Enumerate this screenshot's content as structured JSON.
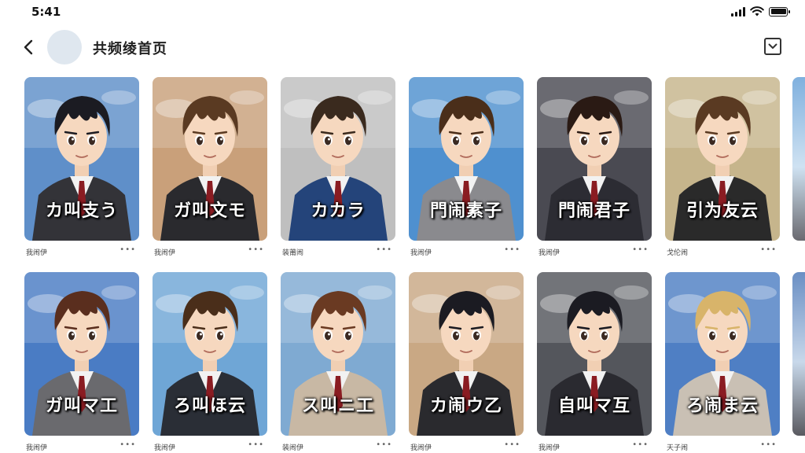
{
  "status": {
    "time": "5:41"
  },
  "header": {
    "title": "共频绫首页"
  },
  "icons": {
    "back": "chevron-left-icon",
    "menu": "dropdown-box-icon",
    "signal": "cellular-signal-icon",
    "wifi": "wifi-icon",
    "battery": "battery-icon"
  },
  "colors": {
    "accent": "#111111",
    "avatar": "#dfe7ef"
  },
  "rows": [
    [
      {
        "title": "カ叫支う",
        "caption": "我闹伊",
        "dots": "•••",
        "bg": "#5f8fc9",
        "hair": "#1b1b22",
        "jacket": "#333338"
      },
      {
        "title": "ガ叫文モ",
        "caption": "我闹伊",
        "dots": "•••",
        "bg": "#c9a07a",
        "hair": "#5a3a22",
        "jacket": "#2a2a2e"
      },
      {
        "title": "カカラ",
        "caption": "装莆闹",
        "dots": "•••",
        "bg": "#bfbfbf",
        "hair": "#3a2a1e",
        "jacket": "#24447a"
      },
      {
        "title": "門闹素子",
        "caption": "我闹伊",
        "dots": "•••",
        "bg": "#4f90cf",
        "hair": "#4a2e1a",
        "jacket": "#8a8a8e"
      },
      {
        "title": "門闹君子",
        "caption": "我闹伊",
        "dots": "•••",
        "bg": "#4a4a52",
        "hair": "#2a1a14",
        "jacket": "#2c2c33"
      },
      {
        "title": "引为友云",
        "caption": "戈伦闹",
        "dots": "•••",
        "bg": "#c6b58c",
        "hair": "#5a3a22",
        "jacket": "#2a2a2a"
      }
    ],
    [
      {
        "title": "ガ叫マ工",
        "caption": "我闹伊",
        "dots": "•••",
        "bg": "#4a7cc4",
        "hair": "#5a2e1e",
        "jacket": "#6a6a6e"
      },
      {
        "title": "ろ叫ほ云",
        "caption": "我闹伊",
        "dots": "•••",
        "bg": "#6fa6d6",
        "hair": "#4a2e1a",
        "jacket": "#2a2e36"
      },
      {
        "title": "ス叫ニ工",
        "caption": "装闹伊",
        "dots": "•••",
        "bg": "#7faad2",
        "hair": "#6a3a22",
        "jacket": "#c8b8a4"
      },
      {
        "title": "カ闹ウ乙",
        "caption": "我闹伊",
        "dots": "•••",
        "bg": "#c9a884",
        "hair": "#1b1b22",
        "jacket": "#2a2a2e"
      },
      {
        "title": "自叫マ互",
        "caption": "我闹伊",
        "dots": "•••",
        "bg": "#54565c",
        "hair": "#1b1b22",
        "jacket": "#2a2a30"
      },
      {
        "title": "ろ闹ま云",
        "caption": "天子闹",
        "dots": "•••",
        "bg": "#4f7fc4",
        "hair": "#d8b46a",
        "jacket": "#c9c0b4"
      }
    ]
  ]
}
